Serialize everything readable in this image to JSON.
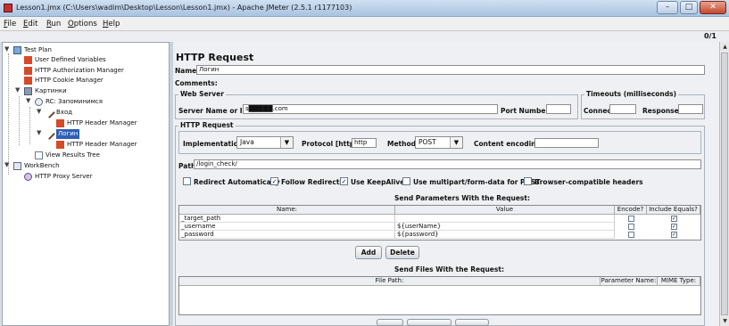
{
  "window": {
    "title": "Lesson1.jmx (C:\\Users\\wadim\\Desktop\\Lesson\\Lesson1.jmx) - Apache JMeter (2.5.1 r1177103)"
  },
  "menu": [
    {
      "label": "File",
      "mnemonic": "F",
      "rest": "ile"
    },
    {
      "label": "Edit",
      "mnemonic": "E",
      "rest": "dit"
    },
    {
      "label": "Run",
      "mnemonic": "R",
      "rest": "un"
    },
    {
      "label": "Options",
      "mnemonic": "O",
      "rest": "ptions"
    },
    {
      "label": "Help",
      "mnemonic": "H",
      "rest": "elp"
    }
  ],
  "status": {
    "counter": "0/1"
  },
  "tree": [
    {
      "label": "Test Plan",
      "icon": "test-plan-icon"
    },
    {
      "label": "User Defined Variables",
      "icon": "config-icon"
    },
    {
      "label": "HTTP Authorization Manager",
      "icon": "config-icon"
    },
    {
      "label": "HTTP Cookie Manager",
      "icon": "config-icon"
    },
    {
      "label": "Картинки",
      "icon": "thread-group-icon"
    },
    {
      "label": "RC: Запоминимся",
      "icon": "controller-icon"
    },
    {
      "label": "Вход",
      "icon": "sampler-icon"
    },
    {
      "label": "HTTP Header Manager",
      "icon": "config-icon"
    },
    {
      "label": "Логин",
      "icon": "sampler-icon",
      "selected": true
    },
    {
      "label": "HTTP Header Manager",
      "icon": "config-icon"
    },
    {
      "label": "View Results Tree",
      "icon": "listener-icon"
    },
    {
      "label": "WorkBench",
      "icon": "workbench-icon"
    },
    {
      "label": "HTTP Proxy Server",
      "icon": "proxy-icon"
    }
  ],
  "form": {
    "heading": "HTTP Request",
    "name_label": "Name:",
    "name_value": "Логин",
    "comments_label": "Comments:",
    "web_server_legend": "Web Server",
    "server_label": "Server Name or IP:",
    "server_value": "s█████.com",
    "port_label": "Port Number:",
    "port_value": "",
    "timeouts_legend": "Timeouts (milliseconds)",
    "connect_label": "Connect:",
    "response_label": "Response:",
    "http_request_legend": "HTTP Request",
    "impl_label": "Implementation:",
    "impl_value": "Java",
    "protocol_label": "Protocol [http]:",
    "protocol_value": "http",
    "method_label": "Method:",
    "method_value": "POST",
    "encoding_label": "Content encoding:",
    "path_label": "Path:",
    "path_value": "/login_check/",
    "options": [
      {
        "label": "Redirect Automatically",
        "checked": false
      },
      {
        "label": "Follow Redirects",
        "checked": true
      },
      {
        "label": "Use KeepAlive",
        "checked": true
      },
      {
        "label": "Use multipart/form-data for POST",
        "checked": false
      },
      {
        "label": "Browser-compatible headers",
        "checked": false
      }
    ],
    "params_title": "Send Parameters With the Request:",
    "params_headers": [
      "Name:",
      "Value",
      "Encode?",
      "Include Equals?"
    ],
    "params_rows": [
      {
        "name": "_target_path",
        "value": "",
        "encode": false,
        "include_equals": true
      },
      {
        "name": "_username",
        "value": "${userName}",
        "encode": false,
        "include_equals": true
      },
      {
        "name": "_password",
        "value": "${password}",
        "encode": false,
        "include_equals": true
      }
    ],
    "add_label": "Add",
    "delete_label": "Delete",
    "files_title": "Send Files With the Request:",
    "files_headers": [
      "File Path:",
      "Parameter Name:",
      "MIME Type:"
    ]
  },
  "colors": {
    "selection": "#2f5fb6",
    "titlebar": "#bcd1ea",
    "close_button": "#c4482f"
  }
}
